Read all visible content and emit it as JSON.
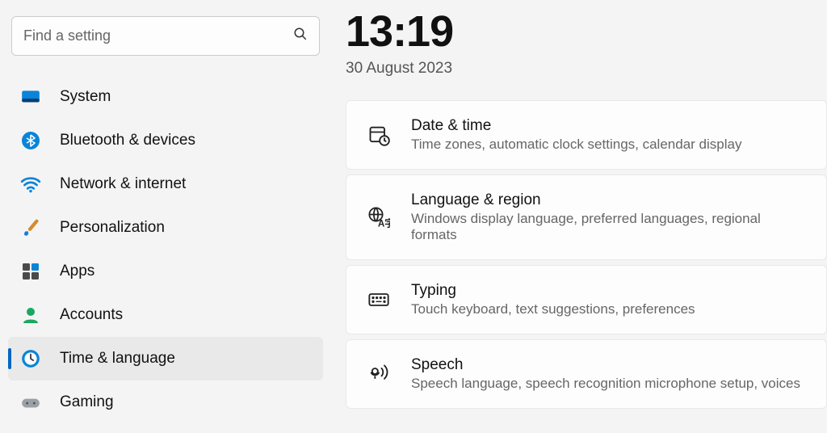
{
  "search": {
    "placeholder": "Find a setting"
  },
  "sidebar": {
    "items": [
      {
        "label": "System"
      },
      {
        "label": "Bluetooth & devices"
      },
      {
        "label": "Network & internet"
      },
      {
        "label": "Personalization"
      },
      {
        "label": "Apps"
      },
      {
        "label": "Accounts"
      },
      {
        "label": "Time & language"
      },
      {
        "label": "Gaming"
      }
    ]
  },
  "header": {
    "time": "13:19",
    "date": "30 August 2023"
  },
  "cards": [
    {
      "title": "Date & time",
      "desc": "Time zones, automatic clock settings, calendar display"
    },
    {
      "title": "Language & region",
      "desc": "Windows display language, preferred languages, regional formats"
    },
    {
      "title": "Typing",
      "desc": "Touch keyboard, text suggestions, preferences"
    },
    {
      "title": "Speech",
      "desc": "Speech language, speech recognition microphone setup, voices"
    }
  ]
}
